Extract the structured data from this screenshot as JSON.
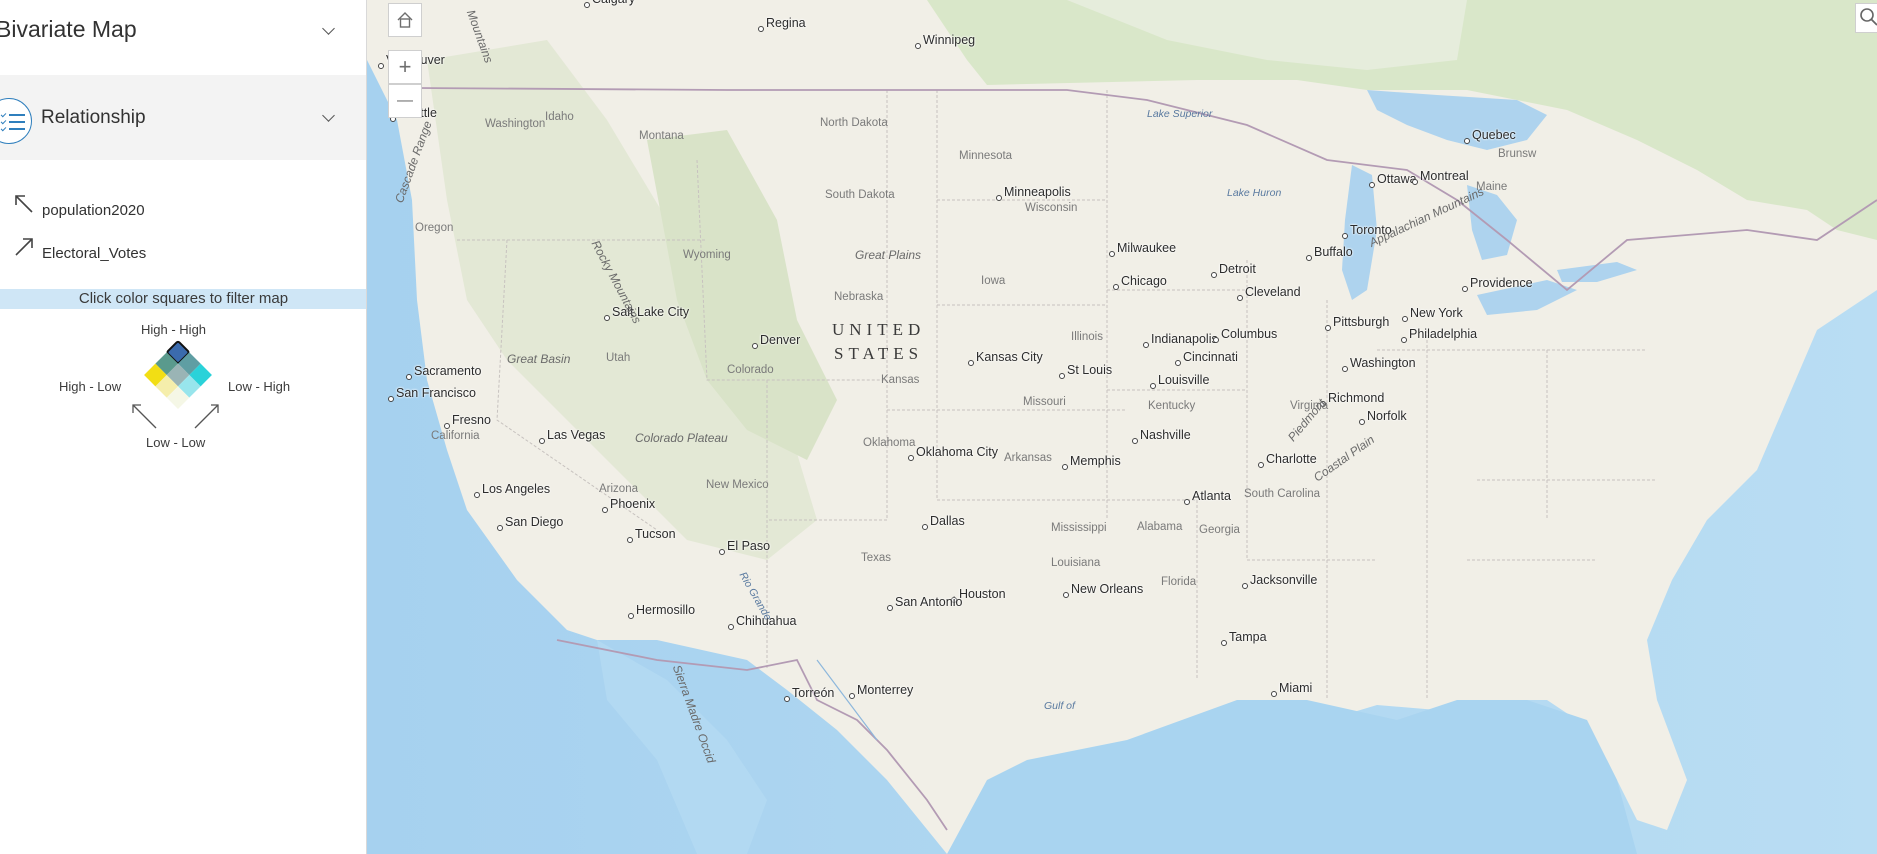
{
  "app": {
    "title": "Bivariate Map"
  },
  "relationship": {
    "title": "Relationship",
    "fields": [
      {
        "name": "population2020",
        "direction": "up-left"
      },
      {
        "name": "Electoral_Votes",
        "direction": "up-right"
      }
    ],
    "filter_hint": "Click color squares to filter map",
    "legend": {
      "top": "High - High",
      "left": "High - Low",
      "right": "Low - High",
      "bottom": "Low - Low",
      "selected_cell": "High - High",
      "colors": {
        "high_high": "#3b6bad",
        "mid_high": "#5f9ea3",
        "high_mid": "#5a9a8d",
        "mid_mid": "#9ab4b5",
        "low_high": "#2ad2d9",
        "high_low": "#f2de14",
        "mid_low": "#f5eeab",
        "low_mid": "#98e5ec",
        "low_low": "#f5f7e6"
      }
    }
  },
  "map_labels": {
    "cities": [
      "Calgary",
      "Regina",
      "Winnipeg",
      "Vancouver",
      "Seattle",
      "Quebec",
      "Ottawa",
      "Montreal",
      "Minneapolis",
      "Toronto",
      "Buffalo",
      "Milwaukee",
      "Detroit",
      "Chicago",
      "Cleveland",
      "Providence",
      "Salt Lake City",
      "Pittsburgh",
      "New York",
      "Denver",
      "Indianapolis",
      "Columbus",
      "Philadelphia",
      "Cincinnati",
      "Kansas City",
      "Washington",
      "Sacramento",
      "St Louis",
      "Louisville",
      "San Francisco",
      "Richmond",
      "Norfolk",
      "Fresno",
      "Las Vegas",
      "Nashville",
      "Oklahoma City",
      "Memphis",
      "Charlotte",
      "Los Angeles",
      "Phoenix",
      "Atlanta",
      "San Diego",
      "Dallas",
      "Tucson",
      "El Paso",
      "Jacksonville",
      "New Orleans",
      "Houston",
      "San Antonio",
      "Hermosillo",
      "Chihuahua",
      "Tampa",
      "Miami",
      "Torreón",
      "Monterrey"
    ],
    "states": [
      "Washington",
      "Montana",
      "North Dakota",
      "Minnesota",
      "Wisconsin",
      "South Dakota",
      "Idaho",
      "Oregon",
      "Wyoming",
      "Nebraska",
      "Iowa",
      "Illinois",
      "Utah",
      "Colorado",
      "Kansas",
      "Missouri",
      "Kentucky",
      "Virginia",
      "California",
      "Oklahoma",
      "Arkansas",
      "New Mexico",
      "Arizona",
      "Texas",
      "Mississippi",
      "Alabama",
      "Georgia",
      "South Carolina",
      "Louisiana",
      "Florida",
      "Maine",
      "Brunsw"
    ],
    "features": [
      "Rocky Mountains",
      "Great Plains",
      "Great Basin",
      "Colorado Plateau",
      "Cascade Range",
      "Appalachian Mountains",
      "Piedmont",
      "Coastal Plain",
      "Sierra Madre Occid",
      "Mountains"
    ],
    "waters": [
      "Lake Superior",
      "Lake Huron",
      "Gulf of",
      "Rio Grande"
    ],
    "country": [
      "UNITED",
      "STATES"
    ]
  },
  "controls": {
    "home": "home-icon",
    "zoom_in": "+",
    "zoom_out": "—",
    "search": "search-icon"
  }
}
